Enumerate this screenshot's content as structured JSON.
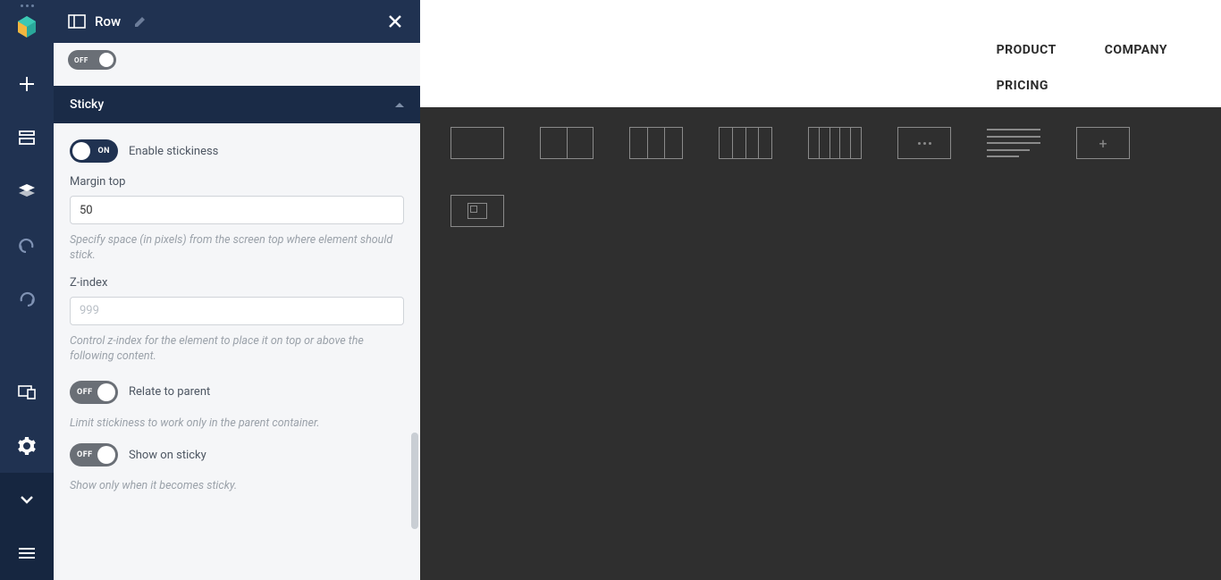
{
  "panel": {
    "title": "Row",
    "section": {
      "title": "Sticky",
      "enable": {
        "state": "ON",
        "label": "Enable stickiness"
      },
      "marginTop": {
        "label": "Margin top",
        "value": "50",
        "help": "Specify space (in pixels) from the screen top where element should stick."
      },
      "zIndex": {
        "label": "Z-index",
        "placeholder": "999",
        "help": "Control z-index for the element to place it on top or above the following content."
      },
      "relateParent": {
        "state": "OFF",
        "label": "Relate to parent",
        "help": "Limit stickiness to work only in the parent container."
      },
      "showOnSticky": {
        "state": "OFF",
        "label": "Show on sticky",
        "help": "Show only when it becomes sticky."
      }
    }
  },
  "nav": {
    "product": "PRODUCT",
    "company": "COMPANY",
    "pricing": "PRICING"
  }
}
